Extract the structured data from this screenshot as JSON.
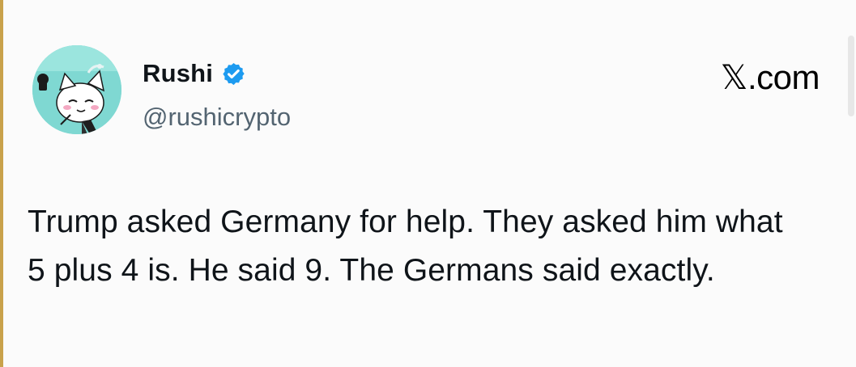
{
  "author": {
    "display_name": "Rushi",
    "handle": "@rushicrypto",
    "verified_icon": "verified-badge-icon",
    "avatar_icon": "cat-avatar-icon"
  },
  "header": {
    "site_label": "𝕏.com"
  },
  "tweet": {
    "text": "Trump asked Germany for help. They asked him what 5 plus 4 is. He said 9. The Germans said exactly."
  },
  "colors": {
    "verified_blue": "#1d9bf0",
    "avatar_teal": "#7dd6d3",
    "handle_gray": "#536471",
    "edge_gold": "#c9a24b"
  }
}
